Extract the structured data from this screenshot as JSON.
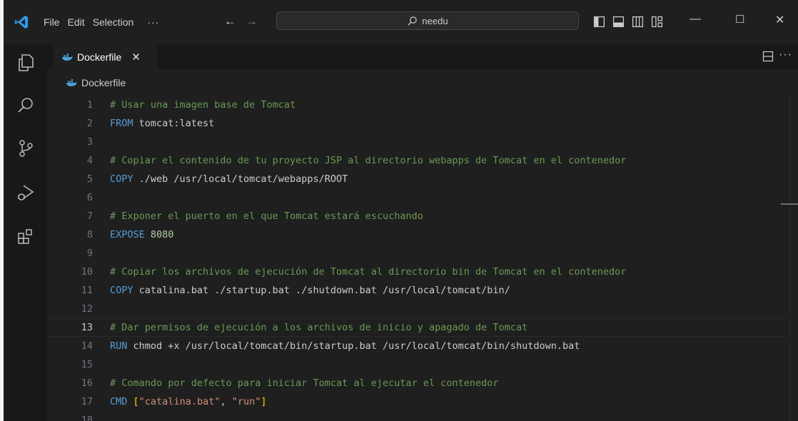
{
  "colors": {
    "accent": "#0078d4",
    "comment": "#6a9955",
    "keyword": "#569cd6",
    "string": "#ce9178",
    "number": "#b5cea8",
    "bracket": "#ffd700"
  },
  "menu": {
    "file": "File",
    "edit": "Edit",
    "selection": "Selection",
    "more": "···"
  },
  "search": {
    "text": "needu",
    "icon": "search-icon"
  },
  "tab": {
    "label": "Dockerfile",
    "close": "✕",
    "icon": "docker-icon"
  },
  "breadcrumb": {
    "label": "Dockerfile",
    "icon": "docker-icon"
  },
  "editor_actions": {
    "more": "···"
  },
  "lines": [
    {
      "num": "1",
      "parts": [
        {
          "t": "# Usar una imagen base de Tomcat",
          "c": "comment"
        }
      ]
    },
    {
      "num": "2",
      "parts": [
        {
          "t": "FROM",
          "c": "keyword"
        },
        {
          "t": " tomcat:latest",
          "c": ""
        }
      ]
    },
    {
      "num": "3",
      "parts": []
    },
    {
      "num": "4",
      "parts": [
        {
          "t": "# Copiar el contenido de tu proyecto JSP al directorio webapps de Tomcat en el contenedor",
          "c": "comment"
        }
      ]
    },
    {
      "num": "5",
      "parts": [
        {
          "t": "COPY",
          "c": "keyword"
        },
        {
          "t": " ./web /usr/local/tomcat/webapps/ROOT",
          "c": ""
        }
      ]
    },
    {
      "num": "6",
      "parts": []
    },
    {
      "num": "7",
      "parts": [
        {
          "t": "# Exponer el puerto en el que Tomcat estará escuchando",
          "c": "comment"
        }
      ]
    },
    {
      "num": "8",
      "parts": [
        {
          "t": "EXPOSE",
          "c": "keyword"
        },
        {
          "t": " ",
          "c": ""
        },
        {
          "t": "8080",
          "c": "number"
        }
      ]
    },
    {
      "num": "9",
      "parts": []
    },
    {
      "num": "10",
      "parts": [
        {
          "t": "# Copiar los archivos de ejecución de Tomcat al directorio bin de Tomcat en el contenedor",
          "c": "comment"
        }
      ]
    },
    {
      "num": "11",
      "parts": [
        {
          "t": "COPY",
          "c": "keyword"
        },
        {
          "t": " catalina.bat ./startup.bat ./shutdown.bat /usr/local/tomcat/bin/",
          "c": ""
        }
      ]
    },
    {
      "num": "12",
      "parts": []
    },
    {
      "num": "13",
      "active": true,
      "parts": [
        {
          "t": "# Dar permisos de ejecución a los archivos de inicio y apagado de Tomcat",
          "c": "comment"
        }
      ]
    },
    {
      "num": "14",
      "parts": [
        {
          "t": "RUN",
          "c": "keyword"
        },
        {
          "t": " chmod +x /usr/local/tomcat/bin/startup.bat /usr/local/tomcat/bin/shutdown.bat",
          "c": ""
        }
      ]
    },
    {
      "num": "15",
      "parts": []
    },
    {
      "num": "16",
      "parts": [
        {
          "t": "# Comando por defecto para iniciar Tomcat al ejecutar el contenedor",
          "c": "comment"
        }
      ]
    },
    {
      "num": "17",
      "parts": [
        {
          "t": "CMD",
          "c": "keyword"
        },
        {
          "t": " ",
          "c": ""
        },
        {
          "t": "[",
          "c": "bracket"
        },
        {
          "t": "\"catalina.bat\"",
          "c": "string"
        },
        {
          "t": ", ",
          "c": ""
        },
        {
          "t": "\"run\"",
          "c": "string"
        },
        {
          "t": "]",
          "c": "bracket"
        }
      ]
    },
    {
      "num": "18",
      "parts": []
    }
  ]
}
